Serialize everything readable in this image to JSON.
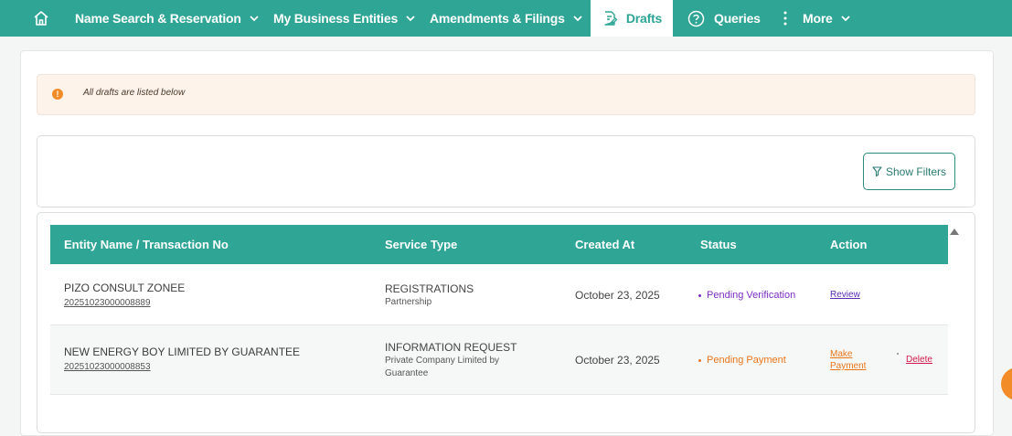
{
  "nav": {
    "items": [
      {
        "label": "Name Search & Reservation"
      },
      {
        "label": "My Business Entities"
      },
      {
        "label": "Amendments & Filings"
      },
      {
        "label": "Drafts"
      },
      {
        "label": "Queries"
      },
      {
        "label": "More"
      }
    ]
  },
  "alert": {
    "icon": "exclamation-circle-icon",
    "text": "All drafts are listed below"
  },
  "filters": {
    "button_label": "Show Filters",
    "icon": "filter-icon"
  },
  "table": {
    "columns": [
      "Entity Name / Transaction No",
      "Service Type",
      "Created At",
      "Status",
      "Action"
    ],
    "rows": [
      {
        "entity_name": "PIZO CONSULT ZONEE",
        "transaction_no": "20251023000008889",
        "service_type": "REGISTRATIONS",
        "service_subtype": "Partnership",
        "created_at": "October 23, 2025",
        "status": "Pending Verification",
        "status_color": "#7a2ec4",
        "actions": {
          "primary": "Review",
          "primary_color": "#5a2bb5"
        }
      },
      {
        "entity_name": "NEW ENERGY BOY LIMITED BY GUARANTEE",
        "transaction_no": "20251023000008853",
        "service_type": "INFORMATION REQUEST",
        "service_subtype_line1": "Private Company Limited by",
        "service_subtype_line2": "Guarantee",
        "created_at": "October 23, 2025",
        "status": "Pending Payment",
        "status_color": "#e8761c",
        "actions": {
          "primary_line1": "Make",
          "primary_line2": "Payment",
          "primary_color": "#e8761c",
          "secondary": "Delete",
          "secondary_color": "#d1184a"
        }
      }
    ]
  },
  "colors": {
    "brand": "#2fa596",
    "accent": "#f28c28"
  }
}
